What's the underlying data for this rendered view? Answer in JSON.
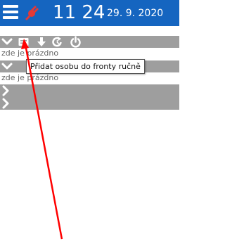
{
  "header": {
    "time": "11 24",
    "date": "29. 9. 2020",
    "menu_icon": "hamburger-icon",
    "status_icon": "plug-icon"
  },
  "toolbar": {
    "icons": [
      "chevron-down-icon",
      "list-card-icon",
      "download-arrow-icon",
      "refresh-icon",
      "power-icon"
    ]
  },
  "sections": [
    {
      "expanded": true,
      "empty_text": "zde je prázdno"
    },
    {
      "expanded": true,
      "empty_text": "zde je prázdno"
    },
    {
      "expanded": false
    },
    {
      "expanded": false
    }
  ],
  "tooltip": {
    "text": "Přidat osobu do fronty ručně"
  },
  "colors": {
    "header_bg": "#1565c0",
    "section_bg": "#9e9e9e",
    "plug": "#e53935",
    "annotation_arrow": "#ff0000"
  }
}
